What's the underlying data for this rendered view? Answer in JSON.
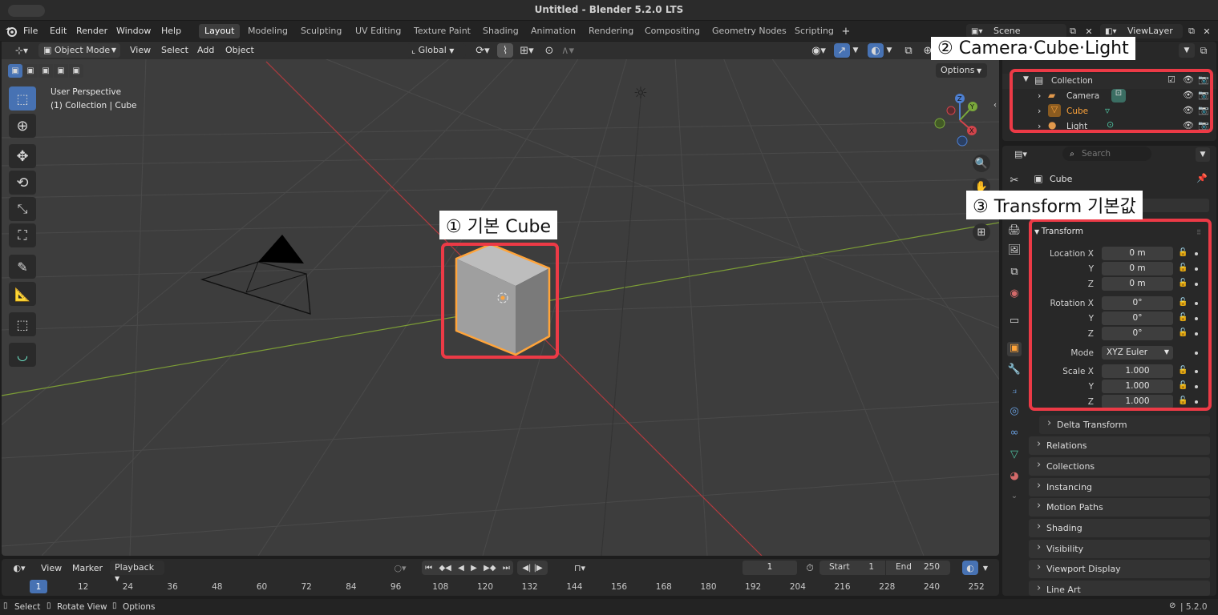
{
  "window": {
    "title": "Untitled - Blender 5.2.0 LTS"
  },
  "menu": [
    "File",
    "Edit",
    "Render",
    "Window",
    "Help"
  ],
  "workspaces": [
    "Layout",
    "Modeling",
    "Sculpting",
    "UV Editing",
    "Texture Paint",
    "Shading",
    "Animation",
    "Rendering",
    "Compositing",
    "Geometry Nodes",
    "Scripting"
  ],
  "workspace_active": "Layout",
  "top_right": {
    "scene": "Scene",
    "view_layer": "ViewLayer"
  },
  "viewport_header": {
    "mode": "Object Mode",
    "menus": [
      "View",
      "Select",
      "Add",
      "Object"
    ],
    "transform_orientation": "Global",
    "options": "Options"
  },
  "viewport_info": {
    "line1": "User Perspective",
    "line2": "(1) Collection | Cube"
  },
  "annotations": {
    "a1": "① 기본 Cube",
    "a2": "② Camera·Cube·Light",
    "a3": "③ Transform 기본값"
  },
  "outliner": {
    "collection": "Collection",
    "items": [
      "Camera",
      "Cube",
      "Light"
    ]
  },
  "properties": {
    "search_placeholder": "Search",
    "object_name": "Cube",
    "transform_panel": "Transform",
    "location_label": "Location X",
    "rotation_label": "Rotation X",
    "scale_label": "Scale X",
    "axis_y": "Y",
    "axis_z": "Z",
    "loc": [
      "0 m",
      "0 m",
      "0 m"
    ],
    "rot": [
      "0°",
      "0°",
      "0°"
    ],
    "mode_label": "Mode",
    "mode_value": "XYZ Euler",
    "scale": [
      "1.000",
      "1.000",
      "1.000"
    ],
    "panels": [
      "Delta Transform",
      "Relations",
      "Collections",
      "Instancing",
      "Motion Paths",
      "Shading",
      "Visibility",
      "Viewport Display",
      "Line Art"
    ]
  },
  "timeline": {
    "menus": [
      "View",
      "Marker"
    ],
    "playback": "Playback",
    "current_frame": "1",
    "start_label": "Start",
    "start": "1",
    "end_label": "End",
    "end": "250",
    "ticks": [
      "1",
      "12",
      "24",
      "36",
      "48",
      "60",
      "72",
      "84",
      "96",
      "108",
      "120",
      "132",
      "144",
      "156",
      "168",
      "180",
      "192",
      "204",
      "216",
      "228",
      "240",
      "252"
    ]
  },
  "statusbar": {
    "items": [
      "Select",
      "Rotate View",
      "Options"
    ],
    "version": "5.2.0"
  },
  "colors": {
    "accent": "#4772b3",
    "annotation_red": "#ec3a46",
    "selection_orange": "#ffa43a",
    "x_axis": "#c8373c",
    "y_axis": "#7fa437"
  }
}
